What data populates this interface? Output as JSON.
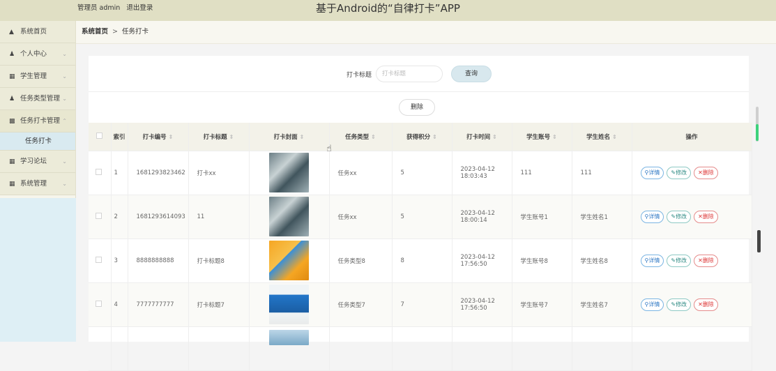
{
  "header": {
    "admin_label": "管理员 admin",
    "logout_label": "退出登录",
    "title": "基于Android的“自律打卡”APP"
  },
  "sidebar": {
    "items": [
      {
        "label": "系统首页",
        "icon": "home-icon"
      },
      {
        "label": "个人中心",
        "icon": "user-icon"
      },
      {
        "label": "学生管理",
        "icon": "grid-icon"
      },
      {
        "label": "任务类型管理",
        "icon": "user-icon"
      },
      {
        "label": "任务打卡管理",
        "icon": "clipboard-icon"
      },
      {
        "label": "学习论坛",
        "icon": "grid-icon"
      },
      {
        "label": "系统管理",
        "icon": "apps-icon"
      }
    ],
    "submenu_active": "任务打卡"
  },
  "breadcrumb": {
    "home": "系统首页",
    "separator": ">",
    "current": "任务打卡"
  },
  "search": {
    "label": "打卡标题",
    "placeholder": "打卡标题",
    "button": "查询"
  },
  "toolbar": {
    "delete_label": "删除"
  },
  "table": {
    "headers": {
      "index": "索引",
      "code": "打卡编号",
      "title": "打卡标题",
      "cover": "打卡封面",
      "type": "任务类型",
      "points": "获得积分",
      "time": "打卡时间",
      "account": "学生账号",
      "name": "学生姓名",
      "actions": "操作"
    },
    "rows": [
      {
        "index": "1",
        "code": "1681293823462",
        "title": "打卡xx",
        "type": "任务xx",
        "points": "5",
        "time": "2023-04-12 18:03:43",
        "account": "111",
        "name": "111"
      },
      {
        "index": "2",
        "code": "1681293614093",
        "title": "11",
        "type": "任务xx",
        "points": "5",
        "time": "2023-04-12 18:00:14",
        "account": "学生账号1",
        "name": "学生姓名1"
      },
      {
        "index": "3",
        "code": "8888888888",
        "title": "打卡标题8",
        "type": "任务类型8",
        "points": "8",
        "time": "2023-04-12 17:56:50",
        "account": "学生账号8",
        "name": "学生姓名8"
      },
      {
        "index": "4",
        "code": "7777777777",
        "title": "打卡标题7",
        "type": "任务类型7",
        "points": "7",
        "time": "2023-04-12 17:56:50",
        "account": "学生账号7",
        "name": "学生姓名7"
      }
    ],
    "actions": {
      "detail": "详情",
      "edit": "修改",
      "delete": "删除"
    }
  }
}
